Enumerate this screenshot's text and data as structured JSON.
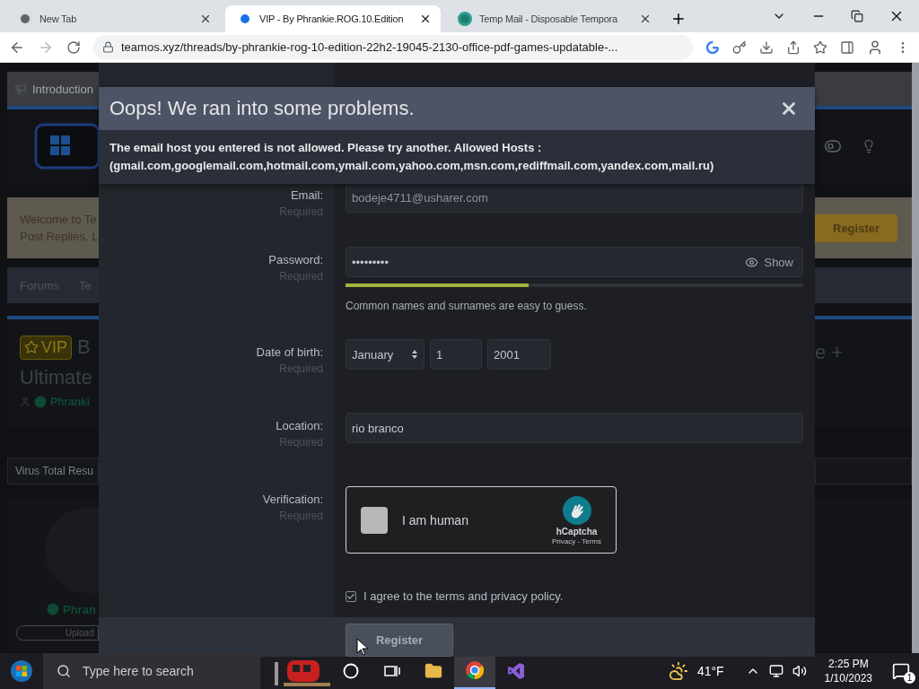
{
  "browser": {
    "tabs": [
      {
        "title": "New Tab",
        "selected": false
      },
      {
        "title": "VIP - By Phrankie.ROG.10.Edition",
        "selected": true
      },
      {
        "title": "Temp Mail - Disposable Tempora",
        "selected": false
      }
    ],
    "url": "teamos.xyz/threads/by-phrankie-rog-10-edition-22h2-19045-2130-office-pdf-games-updatable-..."
  },
  "background_page": {
    "notice": "Introduction",
    "welcome": [
      "Welcome to Te",
      "Post Replies, L"
    ],
    "breadcrumbs": [
      "Forums",
      "Te"
    ],
    "badge": "VIP",
    "title_start": "B",
    "title_line2": "Ultimate",
    "title_end": "e +",
    "author": "Phranki",
    "tab_label": "Virus Total Resu",
    "poster": "Phran",
    "upload": "Upload",
    "register": "Register"
  },
  "modal": {
    "error": {
      "title": "Oops! We ran into some problems.",
      "lines": [
        "The email host you entered is not allowed. Please try another. Allowed Hosts :",
        "(gmail.com,googlemail.com,hotmail.com,ymail.com,yahoo.com,msn.com,rediffmail.com,yandex.com,mail.ru)"
      ]
    },
    "rows": [
      {
        "kind": "text",
        "label": "Email:",
        "hint": "Required",
        "value": "bodeje4711@usharer.com"
      },
      {
        "kind": "password",
        "label": "Password:",
        "hint": "Required",
        "value": "•••••••••",
        "toggle": "Show",
        "level": 0.4,
        "note": "Common names and surnames are easy to guess."
      },
      {
        "kind": "date",
        "label": "Date of birth:",
        "hint": "Required",
        "month": "January",
        "day": "1",
        "year": "2001"
      },
      {
        "kind": "text",
        "label": "Location:",
        "hint": "Required",
        "value": "rio branco"
      },
      {
        "kind": "captcha",
        "label": "Verification:",
        "hint": "Required",
        "checked": false,
        "text": "I am human",
        "brand": "hCaptcha",
        "links": "Privacy - Terms"
      }
    ],
    "agree": {
      "label": "I agree to the terms and privacy policy.",
      "checked": true
    },
    "submit": "Register"
  },
  "taskbar": {
    "search_placeholder": "Type here to search",
    "weather": "41°F",
    "time": "2:25 PM",
    "date": "1/10/2023",
    "notifications": "1"
  }
}
